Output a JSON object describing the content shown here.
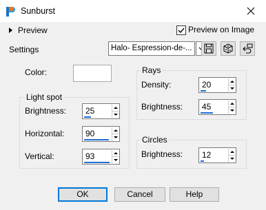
{
  "window": {
    "title": "Sunburst",
    "close_glyph": "✕"
  },
  "preview": {
    "label": "Preview",
    "on_image_label": "Preview on Image",
    "on_image_checked": true
  },
  "settings": {
    "label": "Settings",
    "preset_value": "Halo- Espression-de-..."
  },
  "color": {
    "label": "Color:"
  },
  "light_spot": {
    "title": "Light spot",
    "brightness": {
      "label": "Brightness:",
      "value": "25",
      "fill": 0.25
    },
    "horizontal": {
      "label": "Horizontal:",
      "value": "90",
      "fill": 0.9
    },
    "vertical": {
      "label": "Vertical:",
      "value": "93",
      "fill": 0.93
    }
  },
  "rays": {
    "title": "Rays",
    "density": {
      "label": "Density:",
      "value": "20",
      "fill": 0.2
    },
    "brightness": {
      "label": "Brightness:",
      "value": "45",
      "fill": 0.45
    }
  },
  "circles": {
    "title": "Circles",
    "brightness": {
      "label": "Brightness:",
      "value": "12",
      "fill": 0.12
    }
  },
  "buttons": {
    "ok": "OK",
    "cancel": "Cancel",
    "help": "Help"
  },
  "icons": [
    "app-icon",
    "close-icon",
    "expand-arrow-icon",
    "save-preset-icon",
    "randomize-icon",
    "reset-icon",
    "dropdown-arrow-icon"
  ],
  "colors": {
    "accent": "#0078d7",
    "slider_fill": "#1e6bd2",
    "panel_bg": "#f0f0f0"
  }
}
